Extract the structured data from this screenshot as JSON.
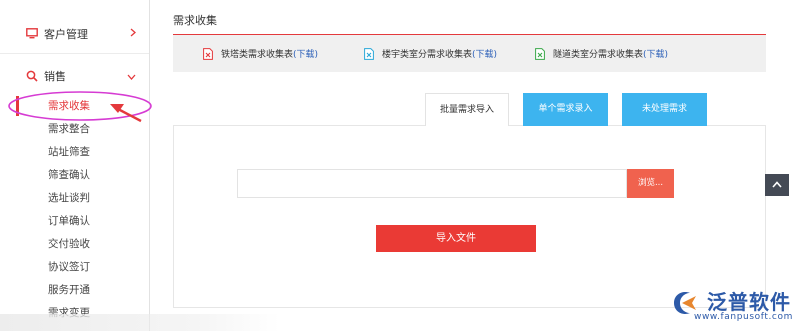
{
  "sidebar": {
    "groups": [
      {
        "label": "客户管理",
        "icon": "monitor-icon",
        "state": "collapsed"
      },
      {
        "label": "销售",
        "icon": "search-icon",
        "state": "expanded"
      }
    ],
    "items": [
      {
        "label": "需求收集",
        "active": true
      },
      {
        "label": "需求整合"
      },
      {
        "label": "站址筛查"
      },
      {
        "label": "筛查确认"
      },
      {
        "label": "选址谈判"
      },
      {
        "label": "订单确认"
      },
      {
        "label": "交付验收"
      },
      {
        "label": "协议签订"
      },
      {
        "label": "服务开通"
      },
      {
        "label": "需求变更"
      }
    ]
  },
  "main": {
    "title": "需求收集",
    "downloads": [
      {
        "name": "铁塔类需求收集表",
        "link": "(下载)",
        "icon": "pdf-file-icon"
      },
      {
        "name": "楼宇类室分需求收集表",
        "link": "(下载)",
        "icon": "excel-file-icon"
      },
      {
        "name": "隧道类室分需求收集表",
        "link": "(下载)",
        "icon": "excel-file-icon"
      }
    ],
    "tabs": [
      {
        "label": "批量需求导入",
        "active": true
      },
      {
        "label": "单个需求录入"
      },
      {
        "label": "未处理需求"
      }
    ],
    "file_input": {
      "value": ""
    },
    "browse_label": "浏览...",
    "import_label": "导入文件"
  },
  "brand": {
    "name": "泛普软件",
    "url": "www.fanpusoft.com"
  },
  "colors": {
    "accent_red": "#e4393c",
    "tab_blue": "#3db4ef",
    "browse_orange": "#f0624e",
    "import_red": "#ea3a35",
    "link_blue": "#2b5fb8",
    "annotation_magenta": "#d63bd3"
  }
}
